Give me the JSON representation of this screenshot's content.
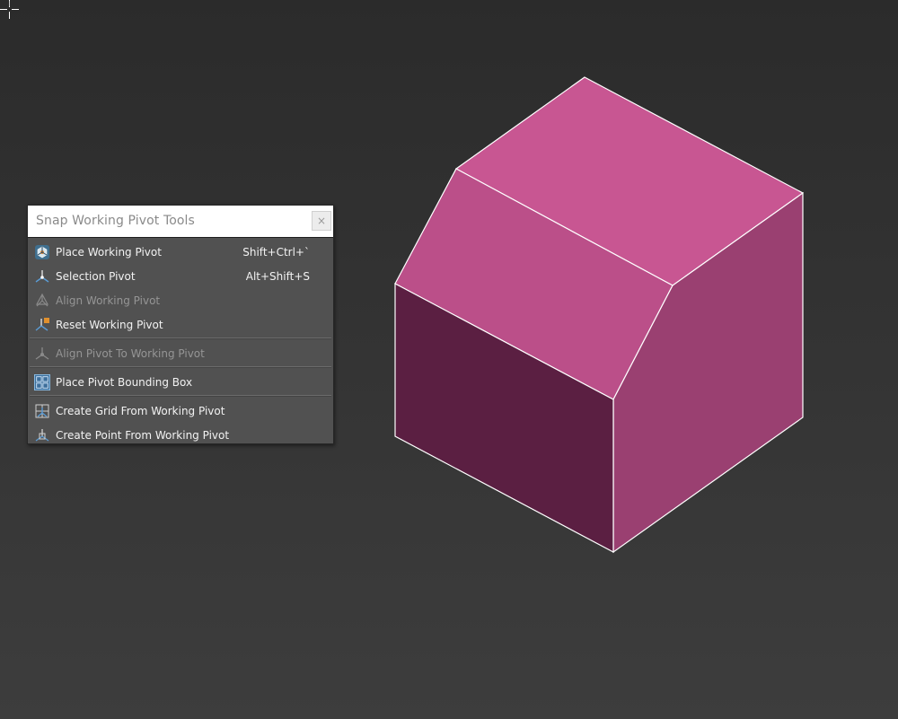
{
  "window": {
    "title": "Snap Working Pivot Tools",
    "close_label": "×"
  },
  "menu": {
    "items": [
      {
        "label": "Place Working Pivot",
        "shortcut": "Shift+Ctrl+`",
        "icon": "place-working-pivot-icon",
        "enabled": true
      },
      {
        "label": "Selection Pivot",
        "shortcut": "Alt+Shift+S",
        "icon": "selection-pivot-icon",
        "enabled": true
      },
      {
        "label": "Align Working Pivot",
        "shortcut": "",
        "icon": "align-working-pivot-icon",
        "enabled": false
      },
      {
        "label": "Reset Working Pivot",
        "shortcut": "",
        "icon": "reset-working-pivot-icon",
        "enabled": true
      },
      {
        "label": "Align Pivot To Working Pivot",
        "shortcut": "",
        "icon": "align-pivot-to-working-pivot-icon",
        "enabled": false
      },
      {
        "label": "Place Pivot Bounding Box",
        "shortcut": "",
        "icon": "place-pivot-bounding-box-icon",
        "enabled": true
      },
      {
        "label": "Create Grid From Working Pivot",
        "shortcut": "",
        "icon": "create-grid-icon",
        "enabled": true
      },
      {
        "label": "Create Point From Working Pivot",
        "shortcut": "",
        "icon": "create-point-icon",
        "enabled": true
      }
    ]
  },
  "viewport": {
    "background_top": "#2b2b2b",
    "background_bottom": "#3d3d3d",
    "object_colors": {
      "top_face": "#c85692",
      "slope_face": "#bb4f89",
      "front_face": "#5b1f42",
      "right_face": "#9a4071",
      "edges": "#ffffff"
    }
  },
  "colors": {
    "panel_bg": "#515151",
    "menu_text": "#f2f2f2",
    "disabled_text": "#959595",
    "title_text": "#8a8a8a"
  }
}
